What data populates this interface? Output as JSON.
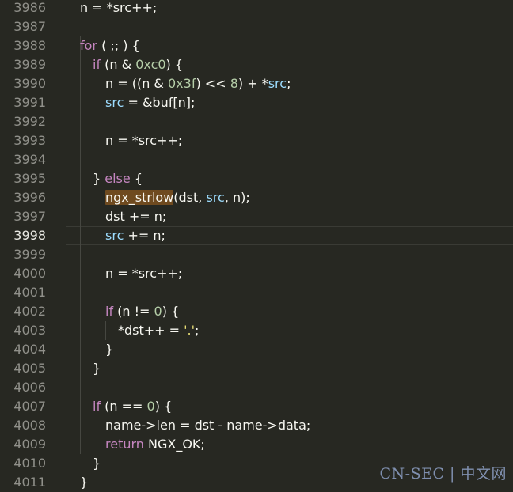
{
  "editor": {
    "active_line": "3998",
    "lines": [
      {
        "n": "3986",
        "tokens": [
          {
            "t": "n = *src++;",
            "c": "plain"
          }
        ]
      },
      {
        "n": "3987",
        "tokens": []
      },
      {
        "n": "3988",
        "tokens": [
          {
            "t": "for",
            "c": "kw"
          },
          {
            "t": " ( ;; ) {",
            "c": "plain"
          }
        ]
      },
      {
        "n": "3989",
        "tokens": [
          {
            "t": "if",
            "c": "kw"
          },
          {
            "t": " (n & ",
            "c": "plain"
          },
          {
            "t": "0xc0",
            "c": "num"
          },
          {
            "t": ") {",
            "c": "plain"
          }
        ]
      },
      {
        "n": "3990",
        "tokens": [
          {
            "t": "n = ((n & ",
            "c": "plain"
          },
          {
            "t": "0x3f",
            "c": "num"
          },
          {
            "t": ") << ",
            "c": "plain"
          },
          {
            "t": "8",
            "c": "num"
          },
          {
            "t": ") + *",
            "c": "plain"
          },
          {
            "t": "src",
            "c": "var"
          },
          {
            "t": ";",
            "c": "plain"
          }
        ]
      },
      {
        "n": "3991",
        "tokens": [
          {
            "t": "src",
            "c": "var"
          },
          {
            "t": " = &buf[n];",
            "c": "plain"
          }
        ]
      },
      {
        "n": "3992",
        "tokens": []
      },
      {
        "n": "3993",
        "tokens": [
          {
            "t": "n = *src++;",
            "c": "plain"
          }
        ]
      },
      {
        "n": "3994",
        "tokens": []
      },
      {
        "n": "3995",
        "tokens": [
          {
            "t": "} ",
            "c": "plain"
          },
          {
            "t": "else",
            "c": "kw"
          },
          {
            "t": " {",
            "c": "plain"
          }
        ]
      },
      {
        "n": "3996",
        "tokens": [
          {
            "t": "ngx_strlow",
            "c": "hl"
          },
          {
            "t": "(dst, ",
            "c": "plain"
          },
          {
            "t": "src",
            "c": "var"
          },
          {
            "t": ", n);",
            "c": "plain"
          }
        ]
      },
      {
        "n": "3997",
        "tokens": [
          {
            "t": "dst += n;",
            "c": "plain"
          }
        ]
      },
      {
        "n": "3998",
        "tokens": [
          {
            "t": "src",
            "c": "var"
          },
          {
            "t": " += n;",
            "c": "plain"
          }
        ]
      },
      {
        "n": "3999",
        "tokens": []
      },
      {
        "n": "4000",
        "tokens": [
          {
            "t": "n = *src++;",
            "c": "plain"
          }
        ]
      },
      {
        "n": "4001",
        "tokens": []
      },
      {
        "n": "4002",
        "tokens": [
          {
            "t": "if",
            "c": "kw"
          },
          {
            "t": " (n != ",
            "c": "plain"
          },
          {
            "t": "0",
            "c": "num"
          },
          {
            "t": ") {",
            "c": "plain"
          }
        ]
      },
      {
        "n": "4003",
        "tokens": [
          {
            "t": "*dst++ = ",
            "c": "plain"
          },
          {
            "t": "'.'",
            "c": "str"
          },
          {
            "t": ";",
            "c": "plain"
          }
        ]
      },
      {
        "n": "4004",
        "tokens": [
          {
            "t": "}",
            "c": "plain"
          }
        ]
      },
      {
        "n": "4005",
        "tokens": [
          {
            "t": "}",
            "c": "plain"
          }
        ]
      },
      {
        "n": "4006",
        "tokens": []
      },
      {
        "n": "4007",
        "tokens": [
          {
            "t": "if",
            "c": "kw"
          },
          {
            "t": " (n == ",
            "c": "plain"
          },
          {
            "t": "0",
            "c": "num"
          },
          {
            "t": ") {",
            "c": "plain"
          }
        ]
      },
      {
        "n": "4008",
        "tokens": [
          {
            "t": "name->len = dst - name->data;",
            "c": "plain"
          }
        ]
      },
      {
        "n": "4009",
        "tokens": [
          {
            "t": "return",
            "c": "kw"
          },
          {
            "t": " NGX_OK;",
            "c": "plain"
          }
        ]
      },
      {
        "n": "4010",
        "tokens": [
          {
            "t": "}",
            "c": "plain"
          }
        ]
      },
      {
        "n": "4011",
        "tokens": [
          {
            "t": "}",
            "c": "plain"
          }
        ]
      }
    ]
  },
  "watermark": "CN-SEC | 中文网"
}
